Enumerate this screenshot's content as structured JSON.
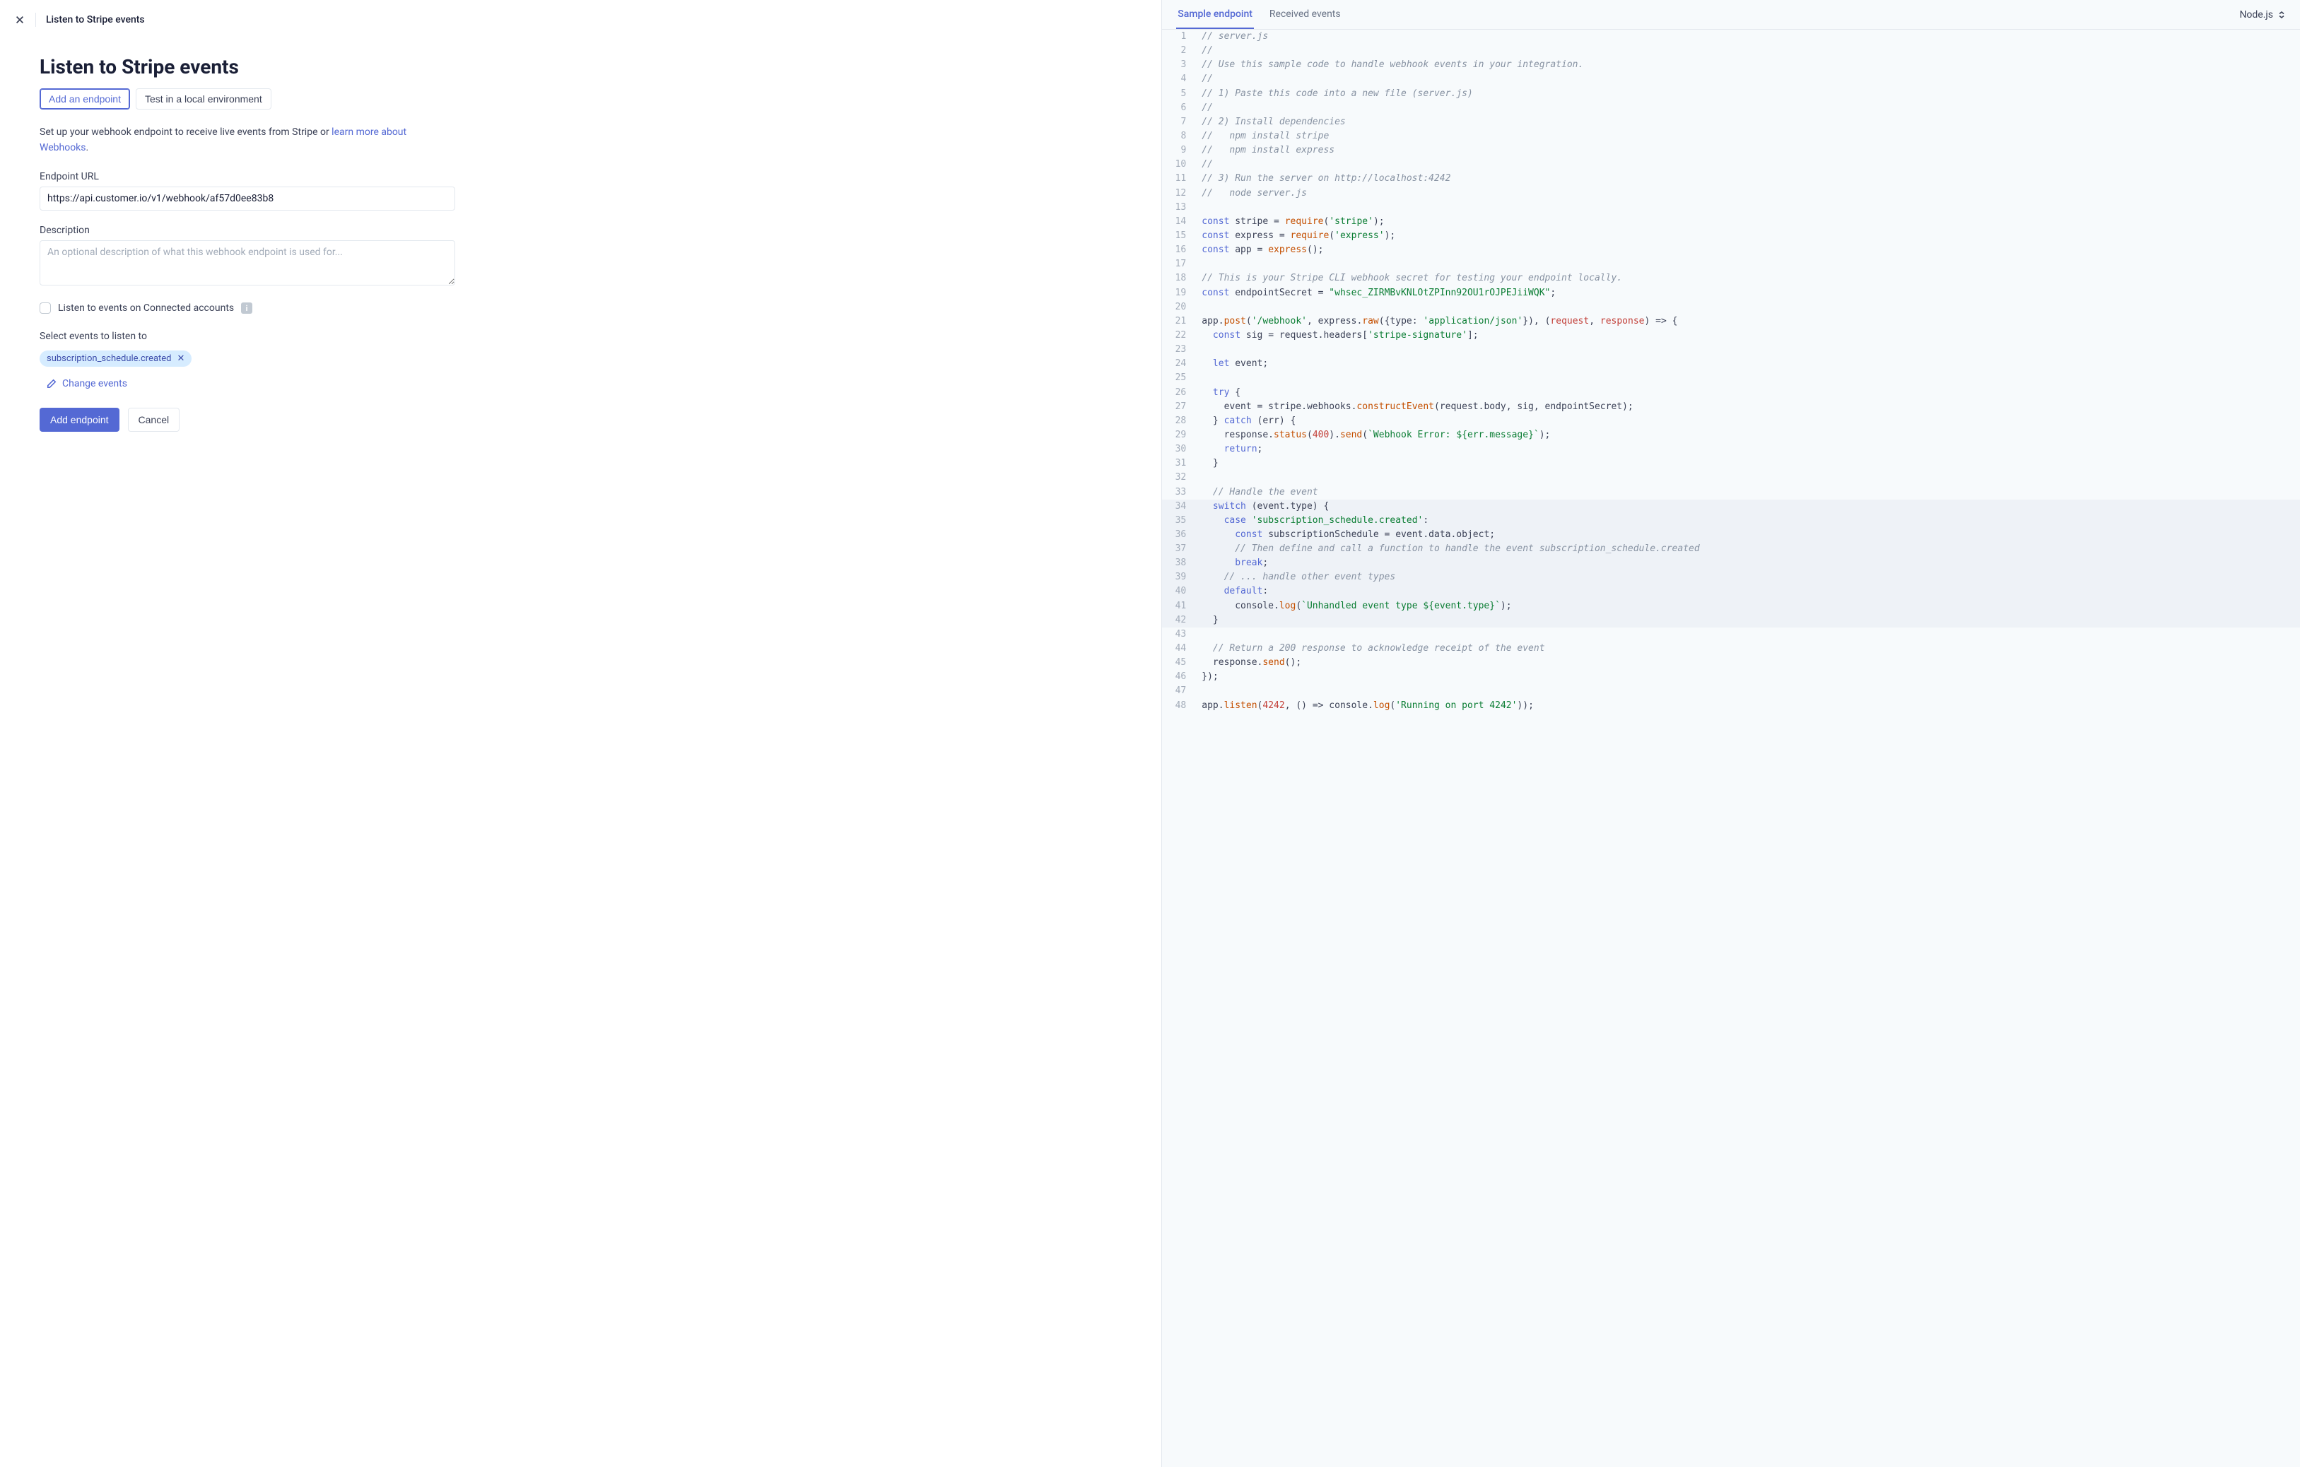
{
  "header": {
    "breadcrumb": "Listen to Stripe events"
  },
  "form": {
    "title": "Listen to Stripe events",
    "tab_add": "Add an endpoint",
    "tab_test": "Test in a local environment",
    "intro_a": "Set up your webhook endpoint to receive live events from Stripe or ",
    "intro_link": "learn more about Webhooks",
    "intro_dot": ".",
    "url_label": "Endpoint URL",
    "url_value": "https://api.customer.io/v1/webhook/af57d0ee83b8",
    "desc_label": "Description",
    "desc_placeholder": "An optional description of what this webhook endpoint is used for...",
    "connected_label": "Listen to events on Connected accounts",
    "events_label": "Select events to listen to",
    "selected_event": "subscription_schedule.created",
    "change_label": "Change events",
    "submit": "Add endpoint",
    "cancel": "Cancel"
  },
  "codepane": {
    "tab_sample": "Sample endpoint",
    "tab_received": "Received events",
    "lang": "Node.js",
    "highlight_start": 34,
    "highlight_end": 42,
    "lines": [
      [
        [
          "comment",
          "// server.js"
        ]
      ],
      [
        [
          "comment",
          "//"
        ]
      ],
      [
        [
          "comment",
          "// Use this sample code to handle webhook events in your integration."
        ]
      ],
      [
        [
          "comment",
          "//"
        ]
      ],
      [
        [
          "comment",
          "// 1) Paste this code into a new file (server.js)"
        ]
      ],
      [
        [
          "comment",
          "//"
        ]
      ],
      [
        [
          "comment",
          "// 2) Install dependencies"
        ]
      ],
      [
        [
          "comment",
          "//   npm install stripe"
        ]
      ],
      [
        [
          "comment",
          "//   npm install express"
        ]
      ],
      [
        [
          "comment",
          "//"
        ]
      ],
      [
        [
          "comment",
          "// 3) Run the server on http://localhost:4242"
        ]
      ],
      [
        [
          "comment",
          "//   node server.js"
        ]
      ],
      [],
      [
        [
          "kw",
          "const"
        ],
        [
          "plain",
          " stripe = "
        ],
        [
          "fn",
          "require"
        ],
        [
          "plain",
          "("
        ],
        [
          "str",
          "'stripe'"
        ],
        [
          "plain",
          ");"
        ]
      ],
      [
        [
          "kw",
          "const"
        ],
        [
          "plain",
          " express = "
        ],
        [
          "fn",
          "require"
        ],
        [
          "plain",
          "("
        ],
        [
          "str",
          "'express'"
        ],
        [
          "plain",
          ");"
        ]
      ],
      [
        [
          "kw",
          "const"
        ],
        [
          "plain",
          " app = "
        ],
        [
          "fn",
          "express"
        ],
        [
          "plain",
          "();"
        ]
      ],
      [],
      [
        [
          "comment",
          "// This is your Stripe CLI webhook secret for testing your endpoint locally."
        ]
      ],
      [
        [
          "kw",
          "const"
        ],
        [
          "plain",
          " endpointSecret = "
        ],
        [
          "str",
          "\"whsec_ZIRMBvKNLOtZPInn92OU1rOJPEJiiWQK\""
        ],
        [
          "plain",
          ";"
        ]
      ],
      [],
      [
        [
          "plain",
          "app."
        ],
        [
          "fn",
          "post"
        ],
        [
          "plain",
          "("
        ],
        [
          "str",
          "'/webhook'"
        ],
        [
          "plain",
          ", express."
        ],
        [
          "fn",
          "raw"
        ],
        [
          "plain",
          "({type: "
        ],
        [
          "str",
          "'application/json'"
        ],
        [
          "plain",
          "}), ("
        ],
        [
          "param",
          "request"
        ],
        [
          "plain",
          ", "
        ],
        [
          "param",
          "response"
        ],
        [
          "plain",
          ") => {"
        ]
      ],
      [
        [
          "plain",
          "  "
        ],
        [
          "kw",
          "const"
        ],
        [
          "plain",
          " sig = request.headers["
        ],
        [
          "str",
          "'stripe-signature'"
        ],
        [
          "plain",
          "];"
        ]
      ],
      [],
      [
        [
          "plain",
          "  "
        ],
        [
          "kw",
          "let"
        ],
        [
          "plain",
          " event;"
        ]
      ],
      [],
      [
        [
          "plain",
          "  "
        ],
        [
          "kw",
          "try"
        ],
        [
          "plain",
          " {"
        ]
      ],
      [
        [
          "plain",
          "    event = stripe.webhooks."
        ],
        [
          "fn",
          "constructEvent"
        ],
        [
          "plain",
          "(request.body, sig, endpointSecret);"
        ]
      ],
      [
        [
          "plain",
          "  } "
        ],
        [
          "kw",
          "catch"
        ],
        [
          "plain",
          " (err) {"
        ]
      ],
      [
        [
          "plain",
          "    response."
        ],
        [
          "fn",
          "status"
        ],
        [
          "plain",
          "("
        ],
        [
          "num",
          "400"
        ],
        [
          "plain",
          ")."
        ],
        [
          "fn",
          "send"
        ],
        [
          "plain",
          "("
        ],
        [
          "tmpl",
          "`Webhook Error: ${err.message}`"
        ],
        [
          "plain",
          ");"
        ]
      ],
      [
        [
          "plain",
          "    "
        ],
        [
          "kw",
          "return"
        ],
        [
          "plain",
          ";"
        ]
      ],
      [
        [
          "plain",
          "  }"
        ]
      ],
      [],
      [
        [
          "plain",
          "  "
        ],
        [
          "comment",
          "// Handle the event"
        ]
      ],
      [
        [
          "plain",
          "  "
        ],
        [
          "kw",
          "switch"
        ],
        [
          "plain",
          " (event.type) {"
        ]
      ],
      [
        [
          "plain",
          "    "
        ],
        [
          "kw",
          "case"
        ],
        [
          "plain",
          " "
        ],
        [
          "str",
          "'subscription_schedule.created'"
        ],
        [
          "plain",
          ":"
        ]
      ],
      [
        [
          "plain",
          "      "
        ],
        [
          "kw",
          "const"
        ],
        [
          "plain",
          " subscriptionSchedule = event.data.object;"
        ]
      ],
      [
        [
          "plain",
          "      "
        ],
        [
          "comment",
          "// Then define and call a function to handle the event subscription_schedule.created"
        ]
      ],
      [
        [
          "plain",
          "      "
        ],
        [
          "kw",
          "break"
        ],
        [
          "plain",
          ";"
        ]
      ],
      [
        [
          "plain",
          "    "
        ],
        [
          "comment",
          "// ... handle other event types"
        ]
      ],
      [
        [
          "plain",
          "    "
        ],
        [
          "kw",
          "default"
        ],
        [
          "plain",
          ":"
        ]
      ],
      [
        [
          "plain",
          "      console."
        ],
        [
          "fn",
          "log"
        ],
        [
          "plain",
          "("
        ],
        [
          "tmpl",
          "`Unhandled event type ${event.type}`"
        ],
        [
          "plain",
          ");"
        ]
      ],
      [
        [
          "plain",
          "  }"
        ]
      ],
      [],
      [
        [
          "plain",
          "  "
        ],
        [
          "comment",
          "// Return a 200 response to acknowledge receipt of the event"
        ]
      ],
      [
        [
          "plain",
          "  response."
        ],
        [
          "fn",
          "send"
        ],
        [
          "plain",
          "();"
        ]
      ],
      [
        [
          "plain",
          "});"
        ]
      ],
      [],
      [
        [
          "plain",
          "app."
        ],
        [
          "fn",
          "listen"
        ],
        [
          "plain",
          "("
        ],
        [
          "num",
          "4242"
        ],
        [
          "plain",
          ", () => console."
        ],
        [
          "fn",
          "log"
        ],
        [
          "plain",
          "("
        ],
        [
          "str",
          "'Running on port 4242'"
        ],
        [
          "plain",
          "));"
        ]
      ]
    ]
  }
}
